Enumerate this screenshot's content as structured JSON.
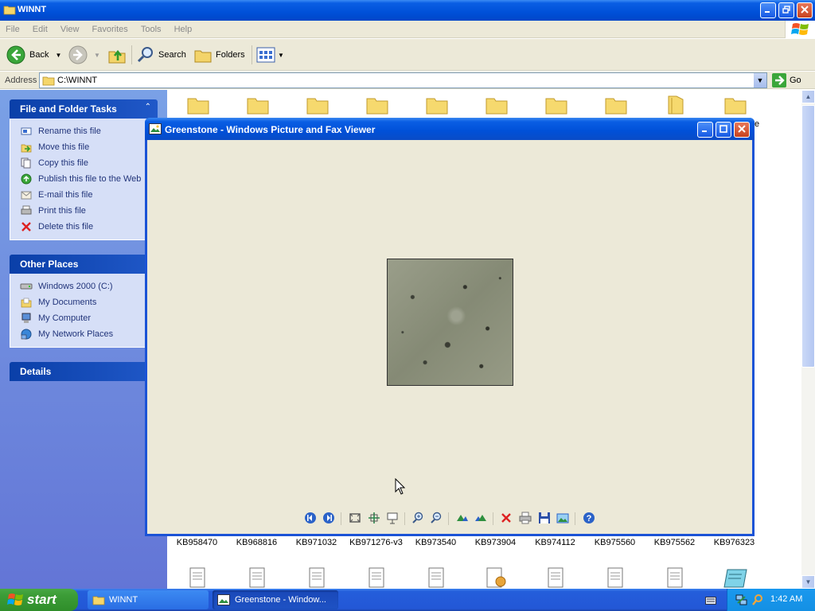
{
  "explorer": {
    "title": "WINNT",
    "menu": [
      "File",
      "Edit",
      "View",
      "Favorites",
      "Tools",
      "Help"
    ],
    "toolbar": {
      "back": "Back",
      "search": "Search",
      "folders": "Folders"
    },
    "address": {
      "label": "Address",
      "value": "C:\\WINNT",
      "go": "Go"
    },
    "sidebar": {
      "file_tasks": {
        "title": "File and Folder Tasks",
        "items": [
          "Rename this file",
          "Move this file",
          "Copy this file",
          "Publish this file to the Web",
          "E-mail this file",
          "Print this file",
          "Delete this file"
        ]
      },
      "other_places": {
        "title": "Other Places",
        "items": [
          "Windows 2000 (C:)",
          "My Documents",
          "My Computer",
          "My Network Places"
        ]
      },
      "details": {
        "title": "Details"
      }
    },
    "files": {
      "names": [
        "KB958470",
        "KB968816",
        "KB971032",
        "KB971276-v3",
        "KB973540",
        "KB973904",
        "KB974112",
        "KB975560",
        "KB975562",
        "KB976323"
      ],
      "partial_label": "e"
    }
  },
  "viewer": {
    "title": "Greenstone - Windows Picture and Fax Viewer"
  },
  "taskbar": {
    "start": "start",
    "tasks": [
      "WINNT",
      "Greenstone - Window..."
    ],
    "clock": "1:42 AM"
  },
  "colors": {
    "titlebar_blue": "#0050d8",
    "sidebar_blue": "#6375d6",
    "start_green": "#3c9c37",
    "close_red": "#c8421e"
  }
}
